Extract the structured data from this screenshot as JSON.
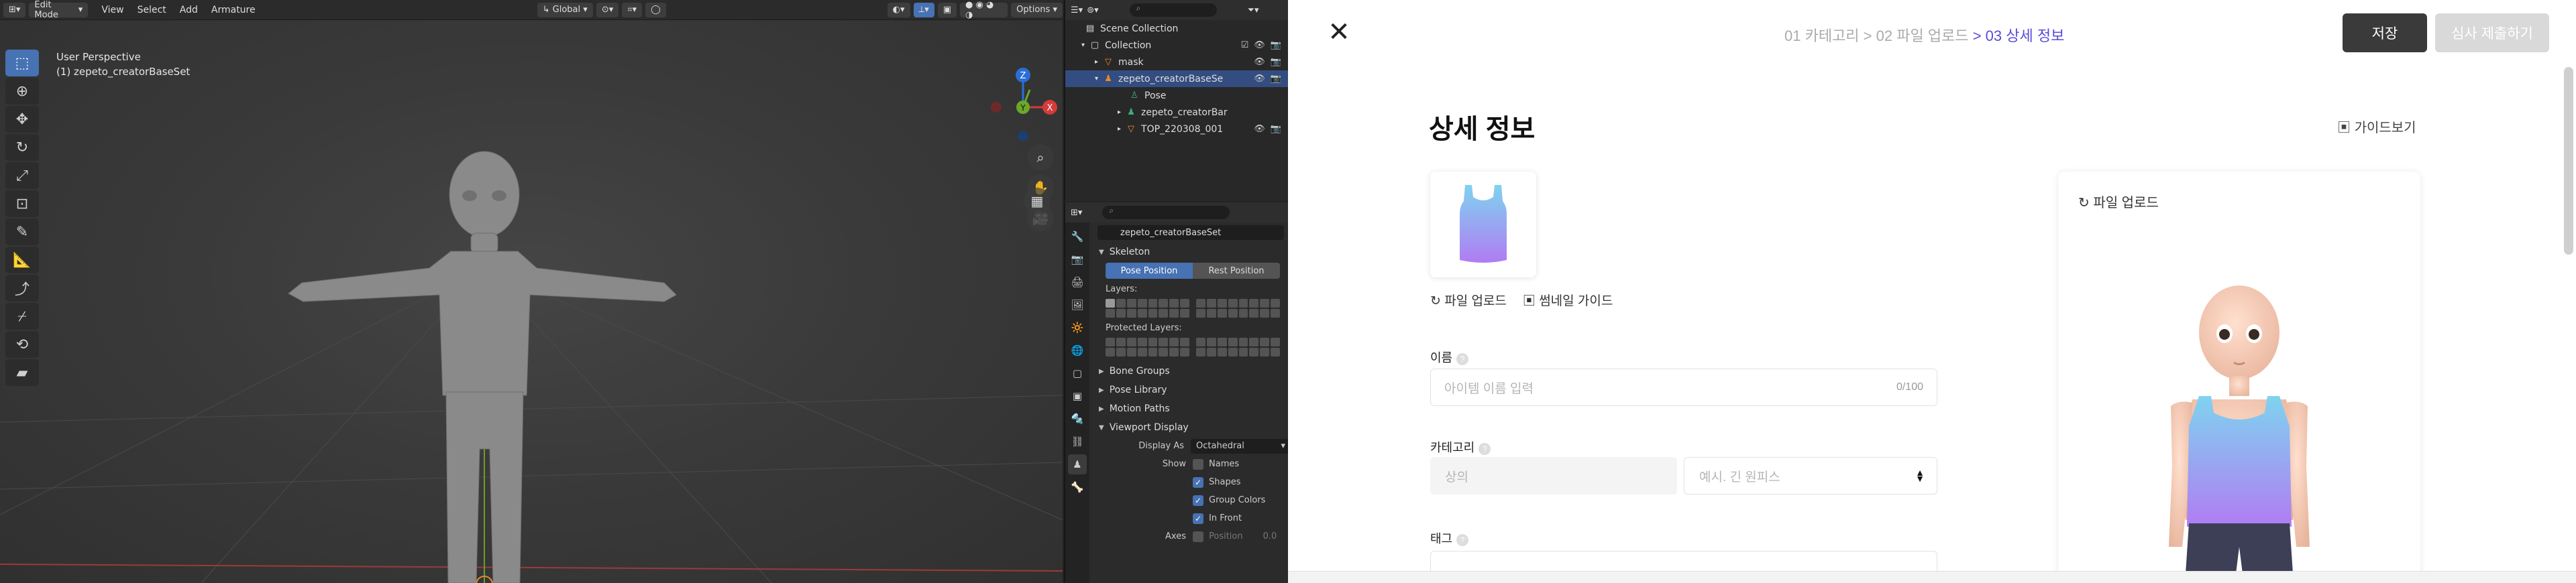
{
  "blender": {
    "header": {
      "mode": "Edit Mode",
      "menus": [
        "View",
        "Select",
        "Add",
        "Armature"
      ],
      "orientation": "Global",
      "options": "Options"
    },
    "viewport": {
      "view_name": "User Perspective",
      "object_name": "(1) zepeto_creatorBaseSet"
    },
    "gizmo_labels": {
      "z": "Z",
      "x": "X",
      "y": "Y"
    },
    "outliner": {
      "search_placeholder": "",
      "rows": [
        {
          "label": "Scene Collection"
        },
        {
          "label": "Collection"
        },
        {
          "label": "mask"
        },
        {
          "label": "zepeto_creatorBaseSe"
        },
        {
          "label": "Pose"
        },
        {
          "label": "zepeto_creatorBar"
        },
        {
          "label": "TOP_220308_001"
        }
      ]
    },
    "properties": {
      "object_field": "zepeto_creatorBaseSet",
      "skeleton_label": "Skeleton",
      "pose_position": "Pose Position",
      "rest_position": "Rest Position",
      "layers_label": "Layers:",
      "protected_layers_label": "Protected Layers:",
      "sections": [
        "Bone Groups",
        "Pose Library",
        "Motion Paths",
        "Viewport Display"
      ],
      "display_as_label": "Display As",
      "display_as_value": "Octahedral",
      "show_label": "Show",
      "show_items": [
        {
          "label": "Names",
          "checked": false
        },
        {
          "label": "Shapes",
          "checked": true
        },
        {
          "label": "Group Colors",
          "checked": true
        },
        {
          "label": "In Front",
          "checked": true
        }
      ],
      "axes_label": "Axes",
      "axes_position": "Position",
      "axes_value": "0.0"
    }
  },
  "web": {
    "breadcrumb": {
      "step1": "01 카테고리",
      "sep1": ">",
      "step2": "02 파일 업로드",
      "sep2": ">",
      "step3": "03 상세 정보"
    },
    "save_label": "저장",
    "submit_label": "심사 제출하기",
    "page_title": "상세 정보",
    "guide_label": "가이드보기",
    "file_upload_label": "파일 업로드",
    "thumbnail_guide_label": "썸네일 가이드",
    "name_label": "이름",
    "name_placeholder": "아이템 이름 입력",
    "name_count": "0/100",
    "category_label": "카테고리",
    "category_value": "상의",
    "subcategory_placeholder": "예시. 긴 원피스",
    "tag_label": "태그",
    "preview_upload_label": "파일 업로드",
    "colors": {
      "accent": "#5a4bd8",
      "save_bg": "#3a3a3a",
      "submit_bg": "#d9d9d9"
    }
  }
}
